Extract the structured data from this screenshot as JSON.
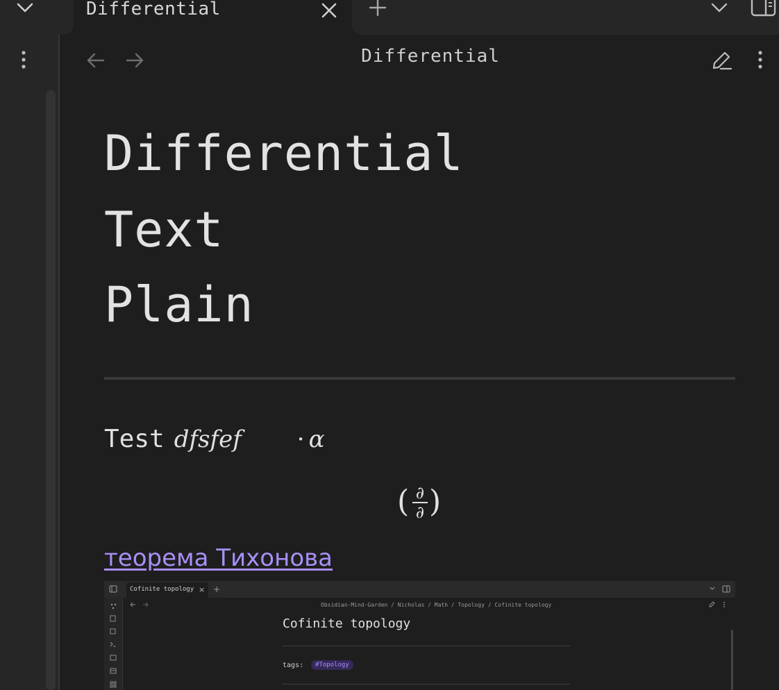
{
  "tabbar": {
    "active_tab_title": "Differential",
    "icons": [
      "chevron-down-icon",
      "close-icon",
      "plus-icon",
      "chevron-down-icon",
      "sidebar-toggle-icon"
    ]
  },
  "header": {
    "title": "Differential",
    "icons": [
      "back-arrow-icon",
      "forward-arrow-icon",
      "pencil-edit-icon",
      "more-vertical-icon"
    ]
  },
  "content": {
    "heading_lines": [
      "Differential",
      "Text",
      "Plain"
    ],
    "test_label": "Test",
    "math_inline": "dfsfef",
    "math_cdot": "·",
    "math_alpha": "α",
    "frac_open": "(",
    "frac_num": "∂",
    "frac_den": "∂",
    "frac_close": ")",
    "link_text": "теорема Тихонова"
  },
  "embedded_screenshot": {
    "tab_title": "Cofinite topology",
    "tab_close": "×",
    "tab_new": "+",
    "breadcrumb": "Obsidian-Mind-Garden / Nicholas / Math / Topology / Cofinite topology",
    "title": "Cofinite topology",
    "tags_label": "tags:",
    "tag": "#Topology"
  },
  "colors": {
    "background": "#1e1e1e",
    "sidebar": "#262626",
    "link": "#a98ff6",
    "text": "#dadada"
  }
}
